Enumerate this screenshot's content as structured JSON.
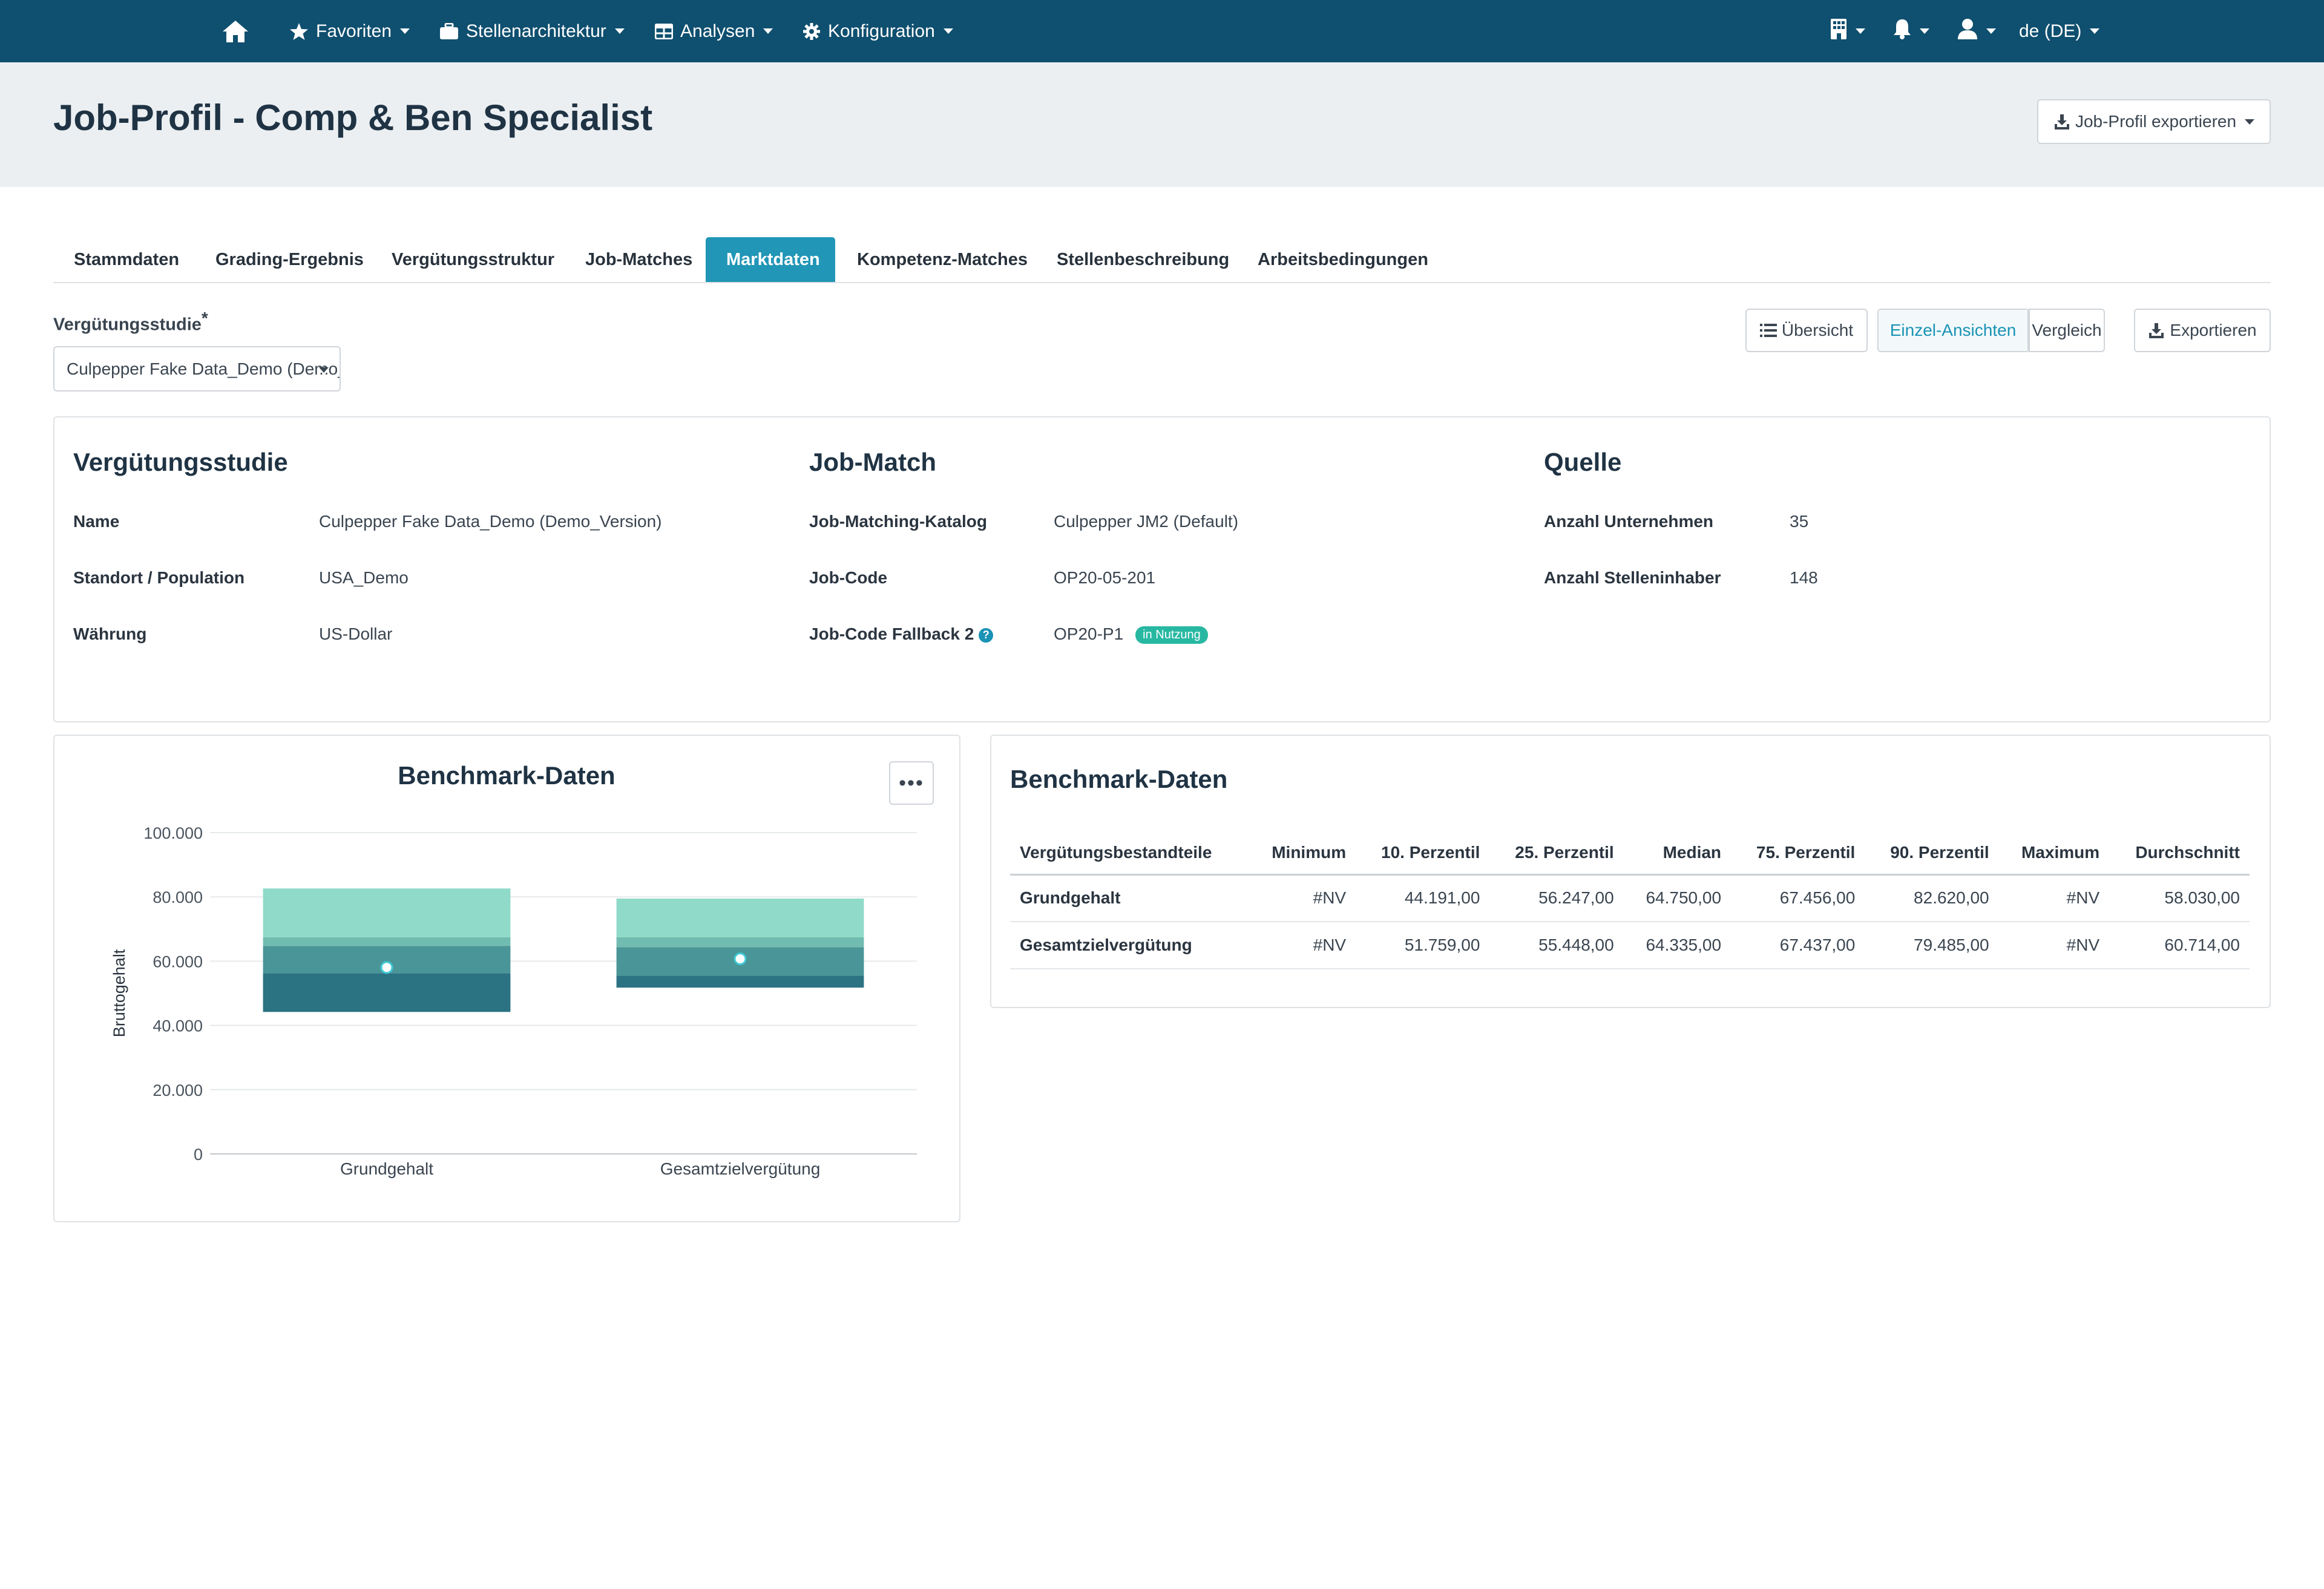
{
  "nav": {
    "items": [
      {
        "label": "Favoriten",
        "icon": "star-icon"
      },
      {
        "label": "Stellenarchitektur",
        "icon": "briefcase-icon"
      },
      {
        "label": "Analysen",
        "icon": "table-icon"
      },
      {
        "label": "Konfiguration",
        "icon": "gear-icon"
      }
    ],
    "language": "de (DE)",
    "bg_color": "#0f4f6f"
  },
  "header": {
    "title": "Job-Profil - Comp & Ben Specialist",
    "export_label": "Job-Profil exportieren"
  },
  "tabs": [
    {
      "label": "Stammdaten"
    },
    {
      "label": "Grading-Ergebnis"
    },
    {
      "label": "Vergütungsstruktur"
    },
    {
      "label": "Job-Matches"
    },
    {
      "label": "Marktdaten",
      "active": true
    },
    {
      "label": "Kompetenz-Matches"
    },
    {
      "label": "Stellenbeschreibung"
    },
    {
      "label": "Arbeitsbedingungen"
    }
  ],
  "study_select": {
    "label": "Vergütungsstudie",
    "required_mark": "*",
    "value": "Culpepper Fake Data_Demo (Demo_Version)"
  },
  "view_buttons": {
    "overview": "Übersicht",
    "single": "Einzel-Ansichten",
    "compare": "Vergleich",
    "export": "Exportieren"
  },
  "info": {
    "study": {
      "title": "Vergütungsstudie",
      "rows": [
        {
          "label": "Name",
          "value": "Culpepper Fake Data_Demo (Demo_Version)"
        },
        {
          "label": "Standort / Population",
          "value": "USA_Demo"
        },
        {
          "label": "Währung",
          "value": "US-Dollar"
        }
      ]
    },
    "job_match": {
      "title": "Job-Match",
      "rows": [
        {
          "label": "Job-Matching-Katalog",
          "value": "Culpepper JM2 (Default)"
        },
        {
          "label": "Job-Code",
          "value": "OP20-05-201"
        },
        {
          "label": "Job-Code Fallback 2",
          "value": "OP20-P1",
          "badge": "in Nutzung"
        }
      ]
    },
    "source": {
      "title": "Quelle",
      "rows": [
        {
          "label": "Anzahl Unternehmen",
          "value": "35"
        },
        {
          "label": "Anzahl Stelleninhaber",
          "value": "148"
        }
      ]
    }
  },
  "chart_title": "Benchmark-Daten",
  "chart_data": {
    "type": "bar",
    "title": "Benchmark-Daten",
    "ylabel": "Bruttogehalt",
    "xlabel": "",
    "ylim": [
      0,
      100000
    ],
    "yticks": [
      0,
      20000,
      40000,
      60000,
      80000,
      100000
    ],
    "ytick_labels": [
      "0",
      "20.000",
      "40.000",
      "60.000",
      "80.000",
      "100.000"
    ],
    "grid": true,
    "categories": [
      "Grundgehalt",
      "Gesamtzielvergütung"
    ],
    "boxes": [
      {
        "category": "Grundgehalt",
        "p10": 44191,
        "p25": 56247,
        "median": 64750,
        "p75": 67456,
        "p90": 82620,
        "mean": 58030
      },
      {
        "category": "Gesamtzielvergütung",
        "p10": 51759,
        "p25": 55448,
        "median": 64335,
        "p75": 67437,
        "p90": 79485,
        "mean": 60714
      }
    ],
    "colors": {
      "p10_p25": "#2b7283",
      "p25_median": "#4a9597",
      "median_p75": "#71bcb0",
      "p75_p90": "#8fdac8",
      "mean_marker": "#3fc9d6"
    }
  },
  "table": {
    "title": "Benchmark-Daten",
    "columns": [
      "Vergütungsbestandteile",
      "Minimum",
      "10. Perzentil",
      "25. Perzentil",
      "Median",
      "75. Perzentil",
      "90. Perzentil",
      "Maximum",
      "Durchschnitt"
    ],
    "rows": [
      [
        "Grundgehalt",
        "#NV",
        "44.191,00",
        "56.247,00",
        "64.750,00",
        "67.456,00",
        "82.620,00",
        "#NV",
        "58.030,00"
      ],
      [
        "Gesamtzielvergütung",
        "#NV",
        "51.759,00",
        "55.448,00",
        "64.335,00",
        "67.437,00",
        "79.485,00",
        "#NV",
        "60.714,00"
      ]
    ]
  }
}
